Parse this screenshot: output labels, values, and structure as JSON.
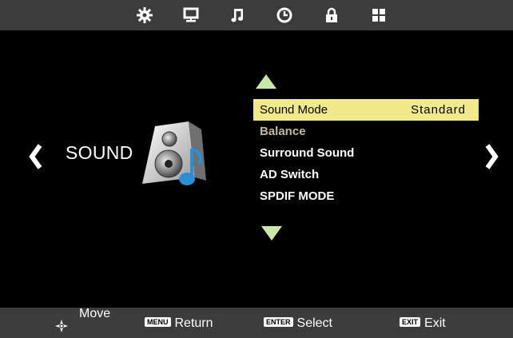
{
  "top_icons": [
    {
      "name": "gear-icon"
    },
    {
      "name": "monitor-icon"
    },
    {
      "name": "music-note-icon"
    },
    {
      "name": "clock-icon"
    },
    {
      "name": "lock-icon"
    },
    {
      "name": "grid-icon"
    }
  ],
  "category": {
    "label": "SOUND",
    "icon": "speaker-music-icon"
  },
  "menu": {
    "items": [
      {
        "label": "Sound Mode",
        "value": "Standard",
        "state": "selected"
      },
      {
        "label": "Balance",
        "value": "",
        "state": "disabled"
      },
      {
        "label": "Surround Sound",
        "value": "",
        "state": "normal"
      },
      {
        "label": "AD Switch",
        "value": "",
        "state": "normal"
      },
      {
        "label": "SPDIF MODE",
        "value": "",
        "state": "normal"
      }
    ]
  },
  "footer": {
    "move_label": "Move",
    "menu_key": "MENU",
    "return_label": "Return",
    "enter_key": "ENTER",
    "select_label": "Select",
    "exit_key": "EXIT",
    "exit_label": "Exit"
  },
  "colors": {
    "topbar": "#3c3c3c",
    "highlight": "#f2ea8a",
    "triangle": "#c8e8a8",
    "disabled_text": "#c4b79f"
  }
}
